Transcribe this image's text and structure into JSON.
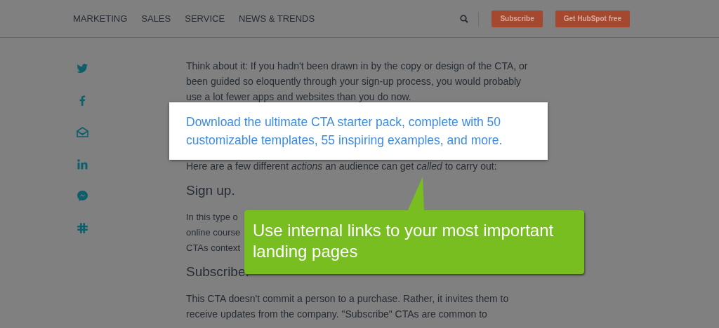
{
  "nav": {
    "links": [
      "MARKETING",
      "SALES",
      "SERVICE",
      "NEWS & TRENDS"
    ],
    "buttons": [
      "Subscribe",
      "Get HubSpot free"
    ]
  },
  "share_icons": [
    {
      "kind": "bird"
    },
    {
      "kind": "f"
    },
    {
      "kind": "envelope"
    },
    {
      "kind": "in"
    },
    {
      "kind": "chat"
    },
    {
      "kind": "hash"
    }
  ],
  "article": [
    {
      "kind": "paragraph",
      "lines": [
        "Think about it: If you hadn't been drawn in by the copy or design of the CTA, or",
        "been guided so eloquently through your sign-up process, you would probably",
        "use a lot fewer apps and websites than you do now."
      ]
    },
    {
      "kind": "cta",
      "lines": [
        "Download the ultimate CTA starter pack, complete with 50",
        "customizable templates, 55 inspiring examples, and more."
      ]
    },
    {
      "kind": "paragraph",
      "lines": [
        "Here are a few different *actions* an audience can get *called* to carry out:"
      ]
    },
    {
      "kind": "heading",
      "lines": [
        "Sign up."
      ]
    },
    {
      "kind": "paragraph",
      "lines": [
        "In this type o",
        "online course",
        "CTAs context"
      ]
    },
    {
      "kind": "heading",
      "lines": [
        "Subscribe."
      ]
    },
    {
      "kind": "paragraph",
      "lines": [
        "This CTA doesn't commit a person to a purchase. Rather, it invites them to",
        "receive updates from the company. \"Subscribe\" CTAs are common to"
      ]
    }
  ],
  "callout": {
    "text": "Use internal links to your most important landing pages"
  }
}
